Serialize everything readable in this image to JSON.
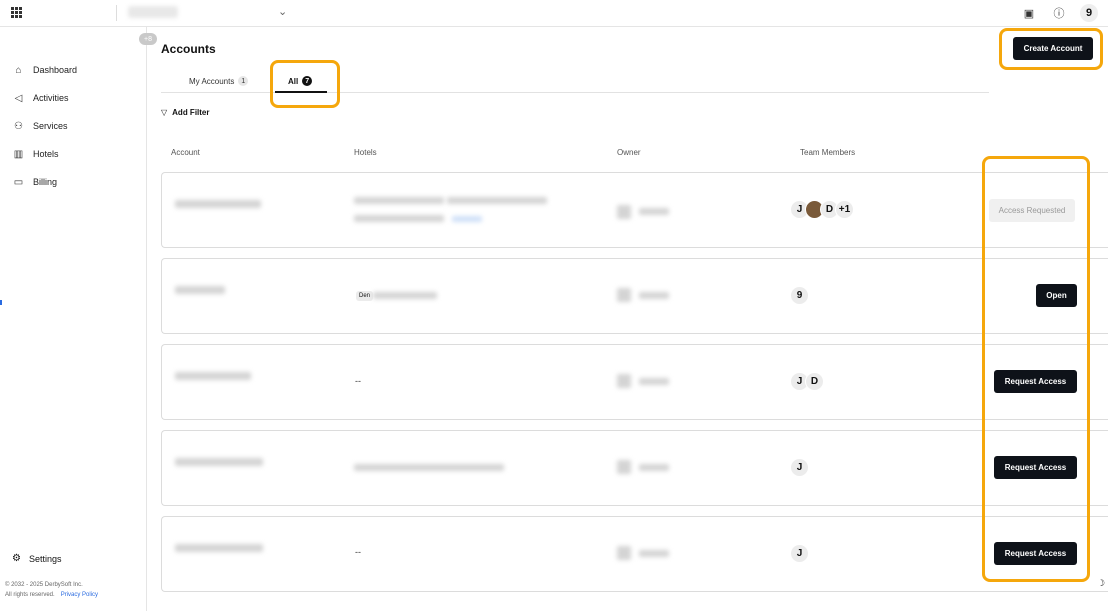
{
  "app": {
    "workspace_placeholder": ""
  },
  "topbar": {
    "user_initial": "9",
    "icons": [
      "apps-grid-icon",
      "chart-icon",
      "help-icon"
    ]
  },
  "sidebar": {
    "collapse_badge": "+8",
    "items": [
      {
        "label": "Dashboard",
        "icon": "dashboard-icon",
        "glyph": "⌂"
      },
      {
        "label": "Activities",
        "icon": "megaphone-icon",
        "glyph": "◁"
      },
      {
        "label": "Services",
        "icon": "services-icon",
        "glyph": "⚇"
      },
      {
        "label": "Hotels",
        "icon": "building-icon",
        "glyph": "▥"
      },
      {
        "label": "Billing",
        "icon": "card-icon",
        "glyph": "▭"
      }
    ],
    "settings_label": "Settings",
    "copyright": "© 2032 - 2025 DerbySoft Inc.",
    "rights": "All rights reserved.",
    "privacy": "Privacy Policy"
  },
  "page": {
    "title": "Accounts",
    "create_button": "Create Account",
    "tabs": [
      {
        "label": "My Accounts",
        "count": "1"
      },
      {
        "label": "All",
        "count": "7"
      }
    ],
    "add_filter": "Add Filter",
    "columns": [
      "Account",
      "Hotels",
      "Owner",
      "Team Members"
    ]
  },
  "rows": [
    {
      "hotels_text": "",
      "hotel_chip": "",
      "team": [
        "J",
        "",
        "D",
        "+1"
      ],
      "action": "Access Requested",
      "action_type": "requested"
    },
    {
      "hotels_text": "",
      "hotel_chip": "Den",
      "team": [
        "9"
      ],
      "action": "Open",
      "action_type": "open"
    },
    {
      "hotels_text": "--",
      "hotel_chip": "",
      "team": [
        "J",
        "D"
      ],
      "action": "Request Access",
      "action_type": "request"
    },
    {
      "hotels_text": "",
      "hotel_chip": "",
      "team": [
        "J"
      ],
      "action": "Request Access",
      "action_type": "request"
    },
    {
      "hotels_text": "--",
      "hotel_chip": "",
      "team": [
        "J"
      ],
      "action": "Request Access",
      "action_type": "request"
    }
  ],
  "colors": {
    "primary": "#0e1219",
    "highlight": "#f5a70c",
    "link": "#2a6be0"
  }
}
